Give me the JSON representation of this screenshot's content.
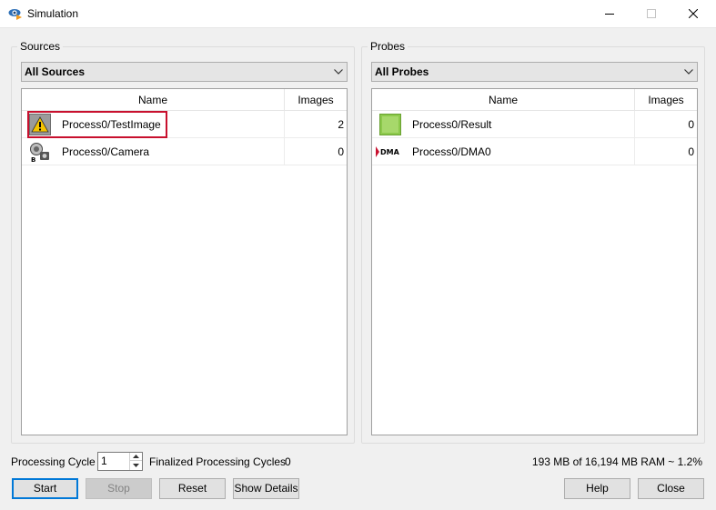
{
  "window": {
    "title": "Simulation"
  },
  "sources": {
    "group_label": "Sources",
    "filter": "All Sources",
    "columns": [
      "Name",
      "Images"
    ],
    "rows": [
      {
        "icon": "warning-icon",
        "name": "Process0/TestImage",
        "images": "2"
      },
      {
        "icon": "camera-icon",
        "name": "Process0/Camera",
        "images": "0"
      }
    ]
  },
  "probes": {
    "group_label": "Probes",
    "filter": "All Probes",
    "columns": [
      "Name",
      "Images"
    ],
    "rows": [
      {
        "icon": "result-icon",
        "name": "Process0/Result",
        "images": "0"
      },
      {
        "icon": "dma-icon",
        "icon_text": "DMA",
        "name": "Process0/DMA0",
        "images": "0"
      }
    ]
  },
  "footer": {
    "processing_cycle_label": "Processing Cycle",
    "processing_cycle_value": "1",
    "finalized_label": "Finalized Processing Cycles",
    "finalized_value": "0",
    "memory": "193 MB of 16,194 MB RAM ~ 1.2%"
  },
  "buttons": {
    "start": "Start",
    "stop": "Stop",
    "reset": "Reset",
    "show_details": "Show Details",
    "help": "Help",
    "close": "Close"
  },
  "colors": {
    "highlight": "#c8102e",
    "default_button_border": "#0078d7",
    "result_green": "#8cc94b"
  }
}
